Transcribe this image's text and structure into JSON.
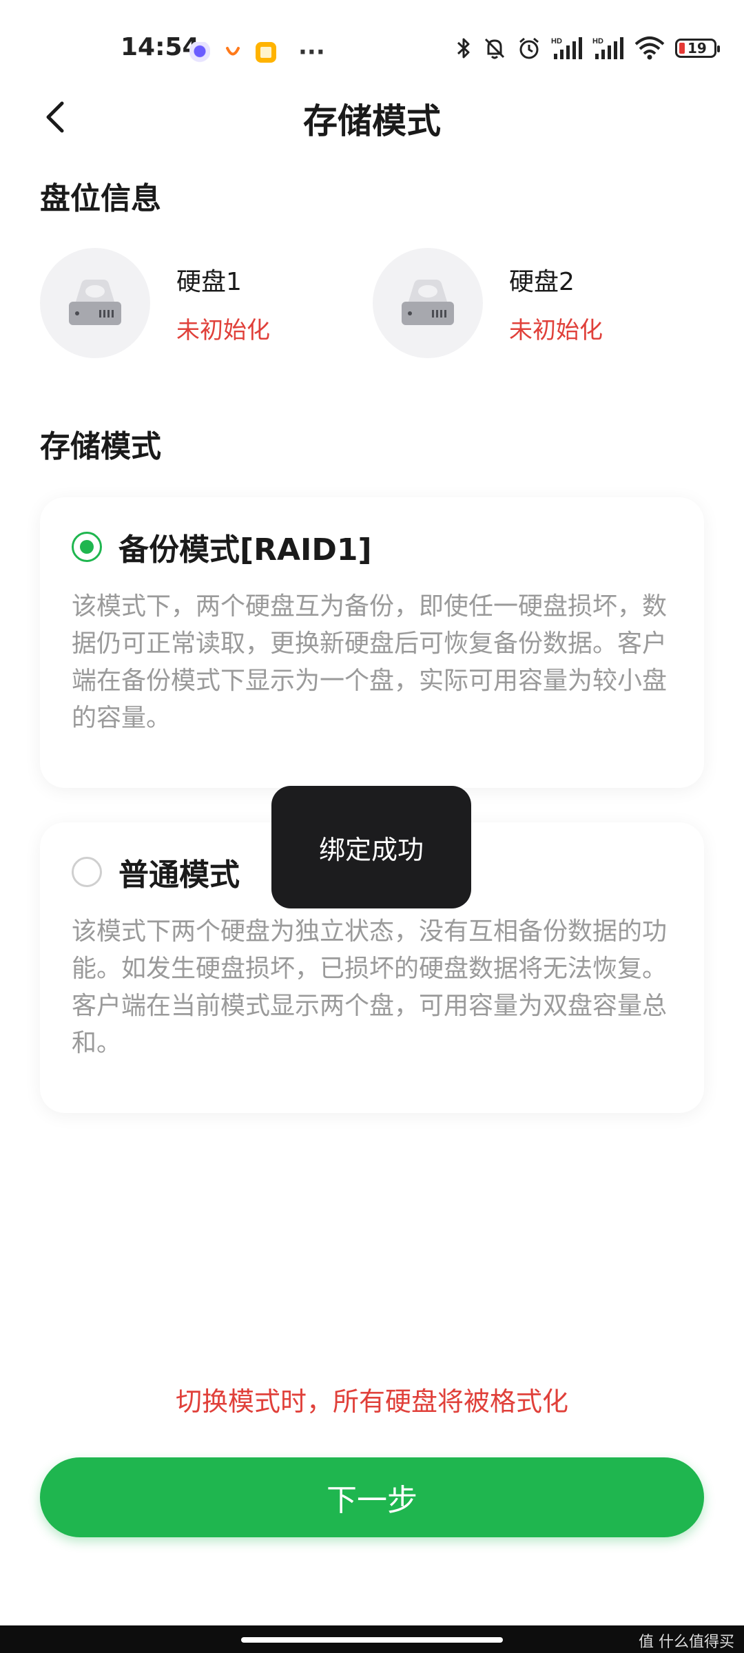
{
  "status_bar": {
    "time": "14:54",
    "more": "···",
    "battery": "19",
    "hd1": "HD",
    "hd2": "HD"
  },
  "header": {
    "title": "存储模式"
  },
  "disk_section": {
    "title": "盘位信息",
    "disks": [
      {
        "name": "硬盘1",
        "status": "未初始化"
      },
      {
        "name": "硬盘2",
        "status": "未初始化"
      }
    ]
  },
  "mode_section": {
    "title": "存储模式",
    "options": [
      {
        "title": "备份模式[RAID1]",
        "selected": true,
        "description": "该模式下，两个硬盘互为备份，即使任一硬盘损坏，数据仍可正常读取，更换新硬盘后可恢复备份数据。客户端在备份模式下显示为一个盘，实际可用容量为较小盘的容量。"
      },
      {
        "title": "普通模式",
        "selected": false,
        "description": "该模式下两个硬盘为独立状态，没有互相备份数据的功能。如发生硬盘损坏，已损坏的硬盘数据将无法恢复。客户端在当前模式显示两个盘，可用容量为双盘容量总和。"
      }
    ]
  },
  "toast": {
    "message": "绑定成功"
  },
  "warning": "切换模式时，所有硬盘将被格式化",
  "next_button": "下一步",
  "watermark": "值 什么值得买",
  "colors": {
    "accent": "#1fb64f",
    "warning": "#e0403a"
  }
}
